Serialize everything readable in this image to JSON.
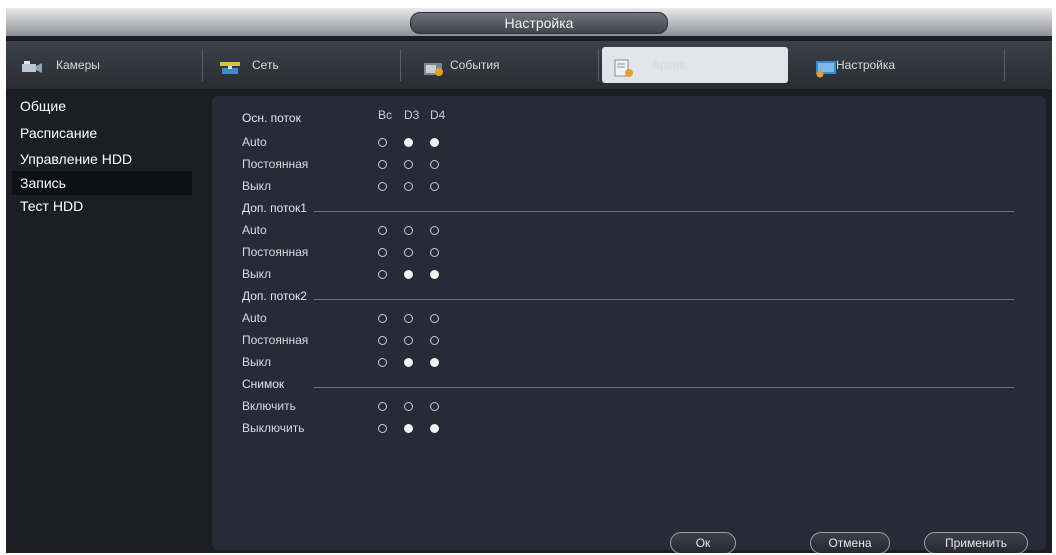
{
  "window": {
    "title": "Настройка"
  },
  "tabs": [
    {
      "label": "Камеры",
      "icon": "camera-icon"
    },
    {
      "label": "Сеть",
      "icon": "network-icon"
    },
    {
      "label": "События",
      "icon": "events-icon"
    },
    {
      "label": "Архив",
      "icon": "storage-icon",
      "active": true
    },
    {
      "label": "Настройка",
      "icon": "settings-icon"
    }
  ],
  "sidebar": {
    "items": [
      {
        "label": "Общие"
      },
      {
        "label": "Расписание"
      },
      {
        "label": "Управление HDD"
      },
      {
        "label": "Запись",
        "selected": true
      },
      {
        "label": "Тест HDD"
      }
    ]
  },
  "record": {
    "main_stream_label": "Осн. поток",
    "columns": [
      "Вс",
      "D3",
      "D4"
    ],
    "groups": [
      {
        "title": "",
        "rows": [
          {
            "label": "Auto",
            "states": [
              false,
              true,
              true
            ]
          },
          {
            "label": "Постоянная",
            "states": [
              false,
              false,
              false
            ]
          },
          {
            "label": "Выкл",
            "states": [
              false,
              false,
              false
            ]
          }
        ]
      },
      {
        "title": "Доп. поток1",
        "rows": [
          {
            "label": "Auto",
            "states": [
              false,
              false,
              false
            ]
          },
          {
            "label": "Постоянная",
            "states": [
              false,
              false,
              false
            ]
          },
          {
            "label": "Выкл",
            "states": [
              false,
              true,
              true
            ]
          }
        ]
      },
      {
        "title": "Доп. поток2",
        "rows": [
          {
            "label": "Auto",
            "states": [
              false,
              false,
              false
            ]
          },
          {
            "label": "Постоянная",
            "states": [
              false,
              false,
              false
            ]
          },
          {
            "label": "Выкл",
            "states": [
              false,
              true,
              true
            ]
          }
        ]
      },
      {
        "title": "Снимок",
        "rows": [
          {
            "label": "Включить",
            "states": [
              false,
              false,
              false
            ]
          },
          {
            "label": "Выключить",
            "states": [
              false,
              true,
              true
            ]
          }
        ]
      }
    ]
  },
  "buttons": {
    "ok": "Ок",
    "cancel": "Отмена",
    "apply": "Применить"
  },
  "colors": {
    "accent": "#1d4f86",
    "panel": "#262b38",
    "background": "#1b1e24"
  }
}
